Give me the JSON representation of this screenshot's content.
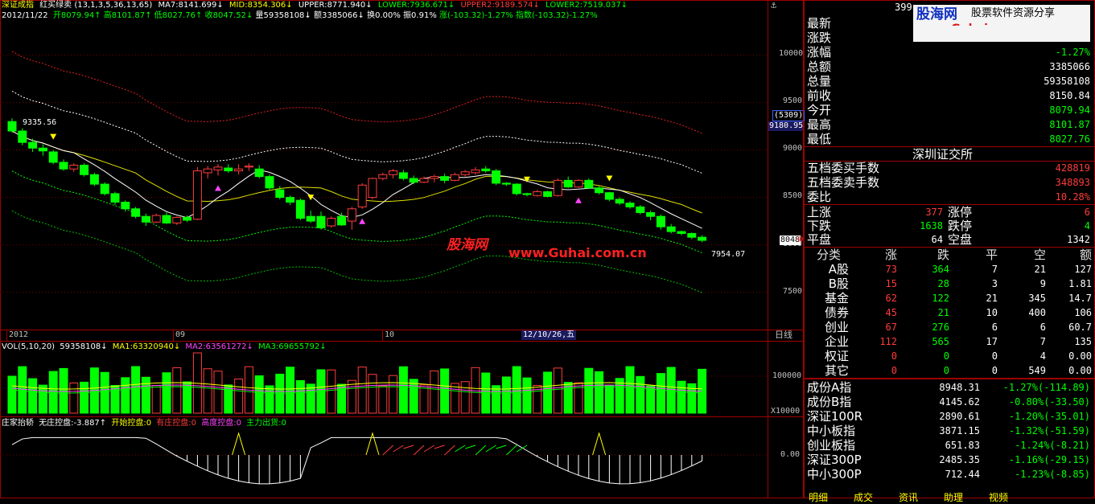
{
  "header": {
    "title": "深证成指",
    "indicator": "红买绿卖",
    "params": "(13,1,3,5,36,13,65)",
    "ma7": "MA7:8141.699↓",
    "mid": "MID:8354.306↓",
    "upper": "UPPER:8771.940↓",
    "lower": "LOWER:7936.671↓",
    "upper2": "UPPER2:9189.574↓",
    "lower2": "LOWER2:7519.037↓"
  },
  "ohlc_line": {
    "date": "2012/11/22",
    "open": "开8079.94↑",
    "high": "高8101.87↑",
    "low": "低8027.76↑",
    "close": "收8047.52↓",
    "volume": "量59358108↓",
    "amount": "额3385066↓",
    "turnover": "换0.00%",
    "amplitude": "振0.91%",
    "change": "涨(-103.32)-1.27%",
    "index_change": "指数(-103.32)-1.27%"
  },
  "price_axis": [
    "10000",
    "9500",
    "9000",
    "8500",
    "8000",
    "7500"
  ],
  "price_axis_extra": {
    "count": "(5309)",
    "value": "9180.95",
    "current": "8048"
  },
  "annotations": {
    "high_point": "9335.56",
    "low_point": "7954.07",
    "watermark_cn": "股海网",
    "watermark_url": "www.Guhai.com.cn"
  },
  "time_axis": {
    "labels": [
      "2012",
      "09",
      "10"
    ],
    "cursor_date": "12/10/26,五",
    "period": "日线"
  },
  "volume_header": {
    "label": "VOL(5,10,20)",
    "value": "59358108↓",
    "ma1": "MA1:63320940↓",
    "ma2": "MA2:63561272↓",
    "ma3": "MA3:69655792↓"
  },
  "volume_axis": {
    "tick": "100000",
    "unit": "X10000"
  },
  "ctrl_header": {
    "name": "庄家抬轿",
    "no_ctrl": "无庄控盘:-3.887↑",
    "start_ctrl": "开始控盘:0",
    "has_ctrl": "有庄控盘:0",
    "high_ctrl": "高度控盘:0",
    "ship_out": "主力出货:0"
  },
  "ctrl_axis": {
    "zero": "0.00"
  },
  "logo": {
    "brand": "股海网",
    "slogan": "股票软件资源分享",
    "url": "www.Guhai.com.cn"
  },
  "top_partial": "399",
  "quote": {
    "rows": [
      {
        "label": "最新",
        "value": ""
      },
      {
        "label": "涨跌",
        "value": ""
      },
      {
        "label": "涨幅",
        "value": "-1.27%"
      },
      {
        "label": "总额",
        "value": "3385066"
      },
      {
        "label": "总量",
        "value": "59358108"
      },
      {
        "label": "前收",
        "value": "8150.84"
      },
      {
        "label": "今开",
        "value": "8079.94"
      },
      {
        "label": "最高",
        "value": "8101.87"
      },
      {
        "label": "最低",
        "value": "8027.76"
      }
    ]
  },
  "exchange": "深圳证交所",
  "orders": [
    {
      "label": "五档委买手数",
      "value": "428819"
    },
    {
      "label": "五档委卖手数",
      "value": "348893"
    },
    {
      "label": "委比",
      "value": "10.28%"
    }
  ],
  "breadth": [
    {
      "l1": "上涨",
      "v1": "377",
      "l2": "涨停",
      "v2": "6"
    },
    {
      "l1": "下跌",
      "v1": "1638",
      "l2": "跌停",
      "v2": "4"
    },
    {
      "l1": "平盘",
      "v1": "64",
      "l2": "空盘",
      "v2": "1342"
    }
  ],
  "category_table": {
    "headers": [
      "分类",
      "涨",
      "跌",
      "平",
      "空",
      "额"
    ],
    "rows": [
      [
        "A股",
        "73",
        "364",
        "7",
        "21",
        "127"
      ],
      [
        "B股",
        "15",
        "28",
        "3",
        "9",
        "1.81"
      ],
      [
        "基金",
        "62",
        "122",
        "21",
        "345",
        "14.7"
      ],
      [
        "债券",
        "45",
        "21",
        "10",
        "400",
        "106"
      ],
      [
        "创业",
        "67",
        "276",
        "6",
        "6",
        "60.7"
      ],
      [
        "企业",
        "112",
        "565",
        "17",
        "7",
        "135"
      ],
      [
        "权证",
        "0",
        "0",
        "0",
        "4",
        "0.00"
      ],
      [
        "其它",
        "0",
        "0",
        "0",
        "549",
        "0.00"
      ]
    ]
  },
  "indices": [
    {
      "name": "成份A指",
      "value": "8948.31",
      "change": "-1.27%(-114.89)"
    },
    {
      "name": "成份B指",
      "value": "4145.62",
      "change": "-0.80%(-33.50)"
    },
    {
      "name": "深证100R",
      "value": "2890.61",
      "change": "-1.20%(-35.01)"
    },
    {
      "name": "中小板指",
      "value": "3871.15",
      "change": "-1.32%(-51.59)"
    },
    {
      "name": "创业板指",
      "value": "651.83",
      "change": "-1.24%(-8.21)"
    },
    {
      "name": "深证300P",
      "value": "2485.35",
      "change": "-1.16%(-29.15)"
    },
    {
      "name": "中小300P",
      "value": "712.44",
      "change": "-1.23%(-8.85)"
    }
  ],
  "bottom_tabs": [
    "明细",
    "成交",
    "资讯",
    "助理",
    "视频"
  ],
  "colors": {
    "up": "#ff3c3c",
    "down": "#00ff00",
    "grid": "#a00000",
    "ma": "#ffff00"
  },
  "chart_data": {
    "type": "candlestick",
    "period": "日线",
    "candles": [
      [
        9300,
        9335,
        9180,
        9200
      ],
      [
        9200,
        9230,
        9050,
        9080
      ],
      [
        9080,
        9120,
        8980,
        9020
      ],
      [
        9020,
        9060,
        8940,
        8990
      ],
      [
        8980,
        9000,
        8850,
        8870
      ],
      [
        8870,
        8900,
        8780,
        8800
      ],
      [
        8800,
        8860,
        8770,
        8840
      ],
      [
        8840,
        8860,
        8720,
        8740
      ],
      [
        8740,
        8760,
        8620,
        8640
      ],
      [
        8640,
        8660,
        8520,
        8540
      ],
      [
        8540,
        8560,
        8420,
        8450
      ],
      [
        8450,
        8470,
        8350,
        8380
      ],
      [
        8380,
        8400,
        8280,
        8300
      ],
      [
        8300,
        8330,
        8200,
        8240
      ],
      [
        8240,
        8330,
        8230,
        8310
      ],
      [
        8310,
        8340,
        8220,
        8230
      ],
      [
        8230,
        8300,
        8210,
        8290
      ],
      [
        8290,
        8310,
        8240,
        8260
      ],
      [
        8270,
        8820,
        8260,
        8780
      ],
      [
        8760,
        8830,
        8700,
        8800
      ],
      [
        8790,
        8850,
        8730,
        8820
      ],
      [
        8810,
        8850,
        8760,
        8780
      ],
      [
        8780,
        8850,
        8740,
        8800
      ],
      [
        8820,
        8860,
        8780,
        8830
      ],
      [
        8800,
        8840,
        8700,
        8720
      ],
      [
        8720,
        8740,
        8580,
        8600
      ],
      [
        8580,
        8620,
        8480,
        8500
      ],
      [
        8500,
        8520,
        8420,
        8450
      ],
      [
        8470,
        8490,
        8260,
        8280
      ],
      [
        8300,
        8360,
        8230,
        8250
      ],
      [
        8300,
        8350,
        8160,
        8180
      ],
      [
        8200,
        8300,
        8180,
        8280
      ],
      [
        8300,
        8340,
        8200,
        8210
      ],
      [
        8250,
        8400,
        8160,
        8380
      ],
      [
        8400,
        8650,
        8380,
        8630
      ],
      [
        8500,
        8710,
        8480,
        8700
      ],
      [
        8700,
        8760,
        8680,
        8740
      ],
      [
        8740,
        8800,
        8700,
        8780
      ],
      [
        8760,
        8790,
        8680,
        8700
      ],
      [
        8700,
        8730,
        8640,
        8660
      ],
      [
        8660,
        8720,
        8650,
        8700
      ],
      [
        8700,
        8740,
        8660,
        8720
      ],
      [
        8720,
        8750,
        8650,
        8680
      ],
      [
        8680,
        8760,
        8670,
        8740
      ],
      [
        8740,
        8790,
        8720,
        8770
      ],
      [
        8760,
        8820,
        8740,
        8790
      ],
      [
        8800,
        8830,
        8760,
        8780
      ],
      [
        8780,
        8800,
        8630,
        8650
      ],
      [
        8650,
        8660,
        8620,
        8640
      ],
      [
        8640,
        8650,
        8520,
        8540
      ],
      [
        8540,
        8550,
        8510,
        8530
      ],
      [
        8520,
        8580,
        8510,
        8560
      ],
      [
        8560,
        8570,
        8500,
        8510
      ],
      [
        8520,
        8700,
        8510,
        8680
      ],
      [
        8680,
        8720,
        8600,
        8610
      ],
      [
        8610,
        8690,
        8600,
        8680
      ],
      [
        8680,
        8700,
        8590,
        8600
      ],
      [
        8600,
        8620,
        8530,
        8550
      ],
      [
        8550,
        8560,
        8460,
        8480
      ],
      [
        8480,
        8500,
        8420,
        8440
      ],
      [
        8440,
        8460,
        8380,
        8400
      ],
      [
        8400,
        8420,
        8320,
        8340
      ],
      [
        8340,
        8360,
        8260,
        8300
      ],
      [
        8300,
        8320,
        8160,
        8190
      ],
      [
        8190,
        8220,
        8120,
        8140
      ],
      [
        8140,
        8150,
        8100,
        8120
      ],
      [
        8120,
        8130,
        8060,
        8080
      ],
      [
        8079.94,
        8101.87,
        8027.76,
        8047.52
      ]
    ]
  }
}
